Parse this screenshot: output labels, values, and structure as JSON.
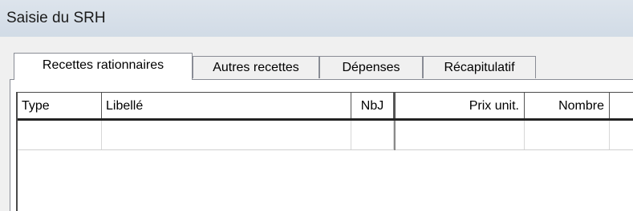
{
  "window": {
    "title": "Saisie du SRH"
  },
  "tabs": [
    {
      "label": "Recettes rationnaires",
      "active": true
    },
    {
      "label": "Autres recettes",
      "active": false
    },
    {
      "label": "Dépenses",
      "active": false
    },
    {
      "label": "Récapitulatif",
      "active": false
    }
  ],
  "grid": {
    "columns": [
      "Type",
      "Libellé",
      "NbJ",
      "Prix unit.",
      "Nombre",
      ""
    ],
    "rows": [
      [
        "",
        "",
        "",
        "",
        "",
        ""
      ]
    ]
  }
}
